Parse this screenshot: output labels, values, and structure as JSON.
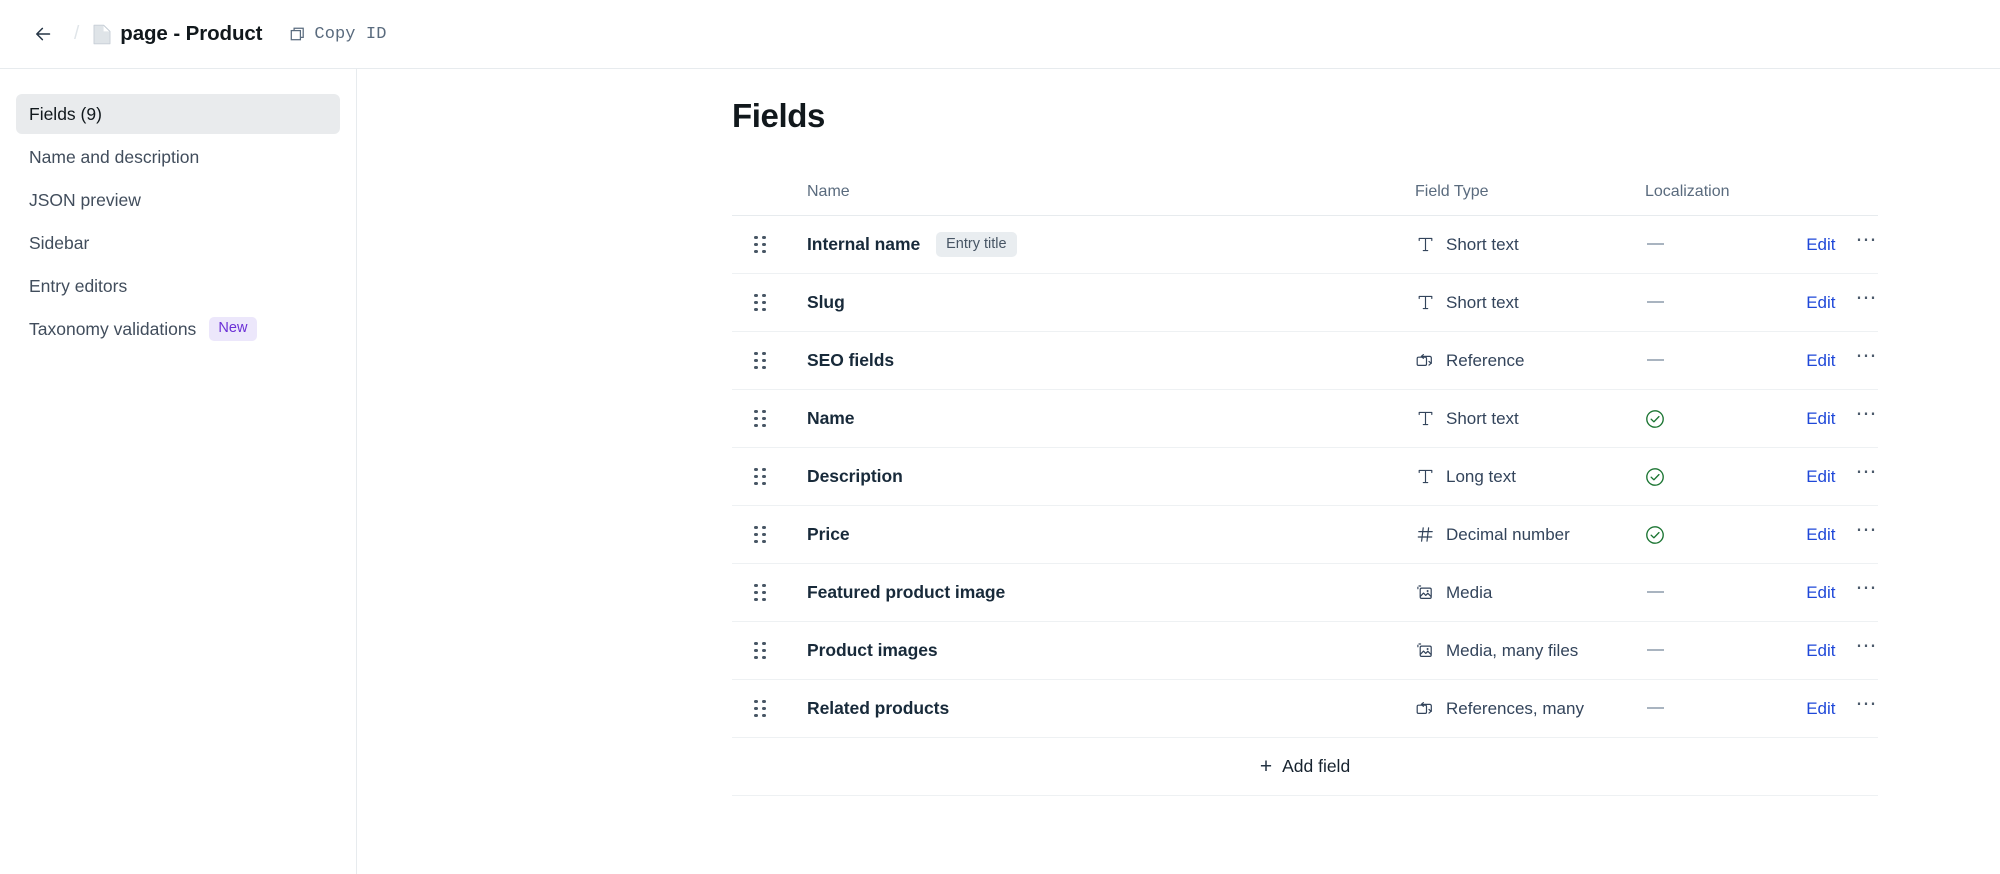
{
  "topbar": {
    "back_label": "back",
    "breadcrumb_separator": "/",
    "doc_icon": "document-icon",
    "title": "page - Product",
    "copy_id_label": "Copy ID",
    "copy_id_icon": "copy-icon"
  },
  "sidebar": {
    "items": [
      {
        "label": "Fields (9)",
        "active": true,
        "badge": null
      },
      {
        "label": "Name and description",
        "active": false,
        "badge": null
      },
      {
        "label": "JSON preview",
        "active": false,
        "badge": null
      },
      {
        "label": "Sidebar",
        "active": false,
        "badge": null
      },
      {
        "label": "Entry editors",
        "active": false,
        "badge": null
      },
      {
        "label": "Taxonomy validations",
        "active": false,
        "badge": "New"
      }
    ]
  },
  "main": {
    "heading": "Fields",
    "columns": [
      "",
      "Name",
      "Field Type",
      "Localization",
      ""
    ],
    "add_field_label": "Add field",
    "add_field_icon": "plus-icon",
    "edit_label": "Edit",
    "kebab_label": "⋯",
    "rows": [
      {
        "handle_icon": "drag-handle-icon",
        "name": "Internal name",
        "badge": "Entry title",
        "type": "Short text",
        "type_icon": "text-icon",
        "localized": false
      },
      {
        "handle_icon": "drag-handle-icon",
        "name": "Slug",
        "badge": null,
        "type": "Short text",
        "type_icon": "text-icon",
        "localized": false
      },
      {
        "handle_icon": "drag-handle-icon",
        "name": "SEO fields",
        "badge": null,
        "type": "Reference",
        "type_icon": "reference-icon",
        "localized": false
      },
      {
        "handle_icon": "drag-handle-icon",
        "name": "Name",
        "badge": null,
        "type": "Short text",
        "type_icon": "text-icon",
        "localized": true
      },
      {
        "handle_icon": "drag-handle-icon",
        "name": "Description",
        "badge": null,
        "type": "Long text",
        "type_icon": "text-icon",
        "localized": true
      },
      {
        "handle_icon": "drag-handle-icon",
        "name": "Price",
        "badge": null,
        "type": "Decimal number",
        "type_icon": "number-icon",
        "localized": true
      },
      {
        "handle_icon": "drag-handle-icon",
        "name": "Featured product image",
        "badge": null,
        "type": "Media",
        "type_icon": "media-icon",
        "localized": false
      },
      {
        "handle_icon": "drag-handle-icon",
        "name": "Product images",
        "badge": null,
        "type": "Media, many files",
        "type_icon": "media-icon",
        "localized": false
      },
      {
        "handle_icon": "drag-handle-icon",
        "name": "Related products",
        "badge": null,
        "type": "References, many",
        "type_icon": "reference-icon",
        "localized": false
      }
    ]
  },
  "colors": {
    "link": "#1f48d8",
    "success": "#1a7431",
    "badge_new_bg": "#ece7fb",
    "badge_new_fg": "#6b2fd6",
    "badge_entry_bg": "#e9edf0",
    "active_nav_bg": "#e9ebed",
    "text_primary": "#11181c",
    "text_muted": "#5a6b7e",
    "border": "#e7ebee"
  }
}
